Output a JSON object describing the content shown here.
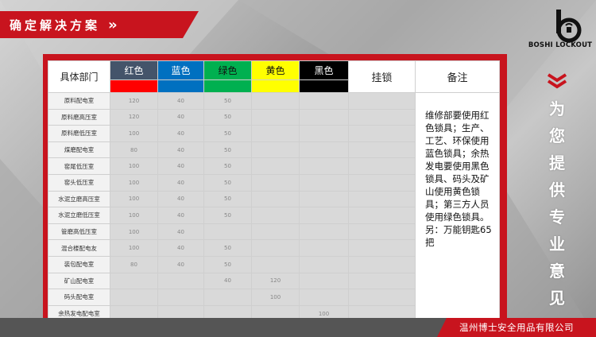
{
  "title": {
    "text": "确定解决方案",
    "chevron": "»"
  },
  "logo": {
    "text": "BOSHI LOCKOUT",
    "icon": "padlock-b-icon"
  },
  "table": {
    "header_dept": "具体部门",
    "colors": [
      {
        "label": "红色",
        "bg": "#44546a",
        "swatch": "#ff0000"
      },
      {
        "label": "蓝色",
        "bg": "#0070c0",
        "swatch": "#0070c0"
      },
      {
        "label": "绿色",
        "bg": "#00b050",
        "swatch": "#00b050"
      },
      {
        "label": "黄色",
        "bg": "#ffff00",
        "swatch": "#ffff00"
      },
      {
        "label": "黑色",
        "bg": "#000000",
        "swatch": "#000000"
      }
    ],
    "header_lock": "挂锁",
    "header_note": "备注",
    "rows": [
      {
        "dept": "原料配电室",
        "values": [
          "120",
          "40",
          "50",
          "",
          ""
        ]
      },
      {
        "dept": "原料磨高压室",
        "values": [
          "120",
          "40",
          "50",
          "",
          ""
        ]
      },
      {
        "dept": "原料磨低压室",
        "values": [
          "100",
          "40",
          "50",
          "",
          ""
        ]
      },
      {
        "dept": "煤磨配电室",
        "values": [
          "80",
          "40",
          "50",
          "",
          ""
        ]
      },
      {
        "dept": "窑尾低压室",
        "values": [
          "100",
          "40",
          "50",
          "",
          ""
        ]
      },
      {
        "dept": "窑头低压室",
        "values": [
          "100",
          "40",
          "50",
          "",
          ""
        ]
      },
      {
        "dept": "水泥立磨高压室",
        "values": [
          "100",
          "40",
          "50",
          "",
          ""
        ]
      },
      {
        "dept": "水泥立磨低压室",
        "values": [
          "100",
          "40",
          "50",
          "",
          ""
        ]
      },
      {
        "dept": "管磨高低压室",
        "values": [
          "100",
          "40",
          "",
          "",
          ""
        ]
      },
      {
        "dept": "混合楼配电友",
        "values": [
          "100",
          "40",
          "50",
          "",
          ""
        ]
      },
      {
        "dept": "装包配电室",
        "values": [
          "80",
          "40",
          "50",
          "",
          ""
        ]
      },
      {
        "dept": "矿山配电室",
        "values": [
          "",
          "",
          "40",
          "120",
          ""
        ]
      },
      {
        "dept": "码头配电室",
        "values": [
          "",
          "",
          "",
          "100",
          ""
        ]
      },
      {
        "dept": "余热发电配电室",
        "values": [
          "",
          "",
          "",
          "",
          "100"
        ]
      }
    ],
    "note": "维修部要使用红色锁具；生产、工艺、环保使用蓝色锁具；余热发电要使用黑色锁具、码头及矿山使用黄色锁具；第三方人员使用绿色锁具。",
    "note_extra": "另：万能钥匙65把"
  },
  "side": {
    "chars": [
      "为",
      "您",
      "提",
      "供",
      "专",
      "业",
      "意",
      "见"
    ]
  },
  "footer": {
    "company": "温州博士安全用品有限公司"
  }
}
